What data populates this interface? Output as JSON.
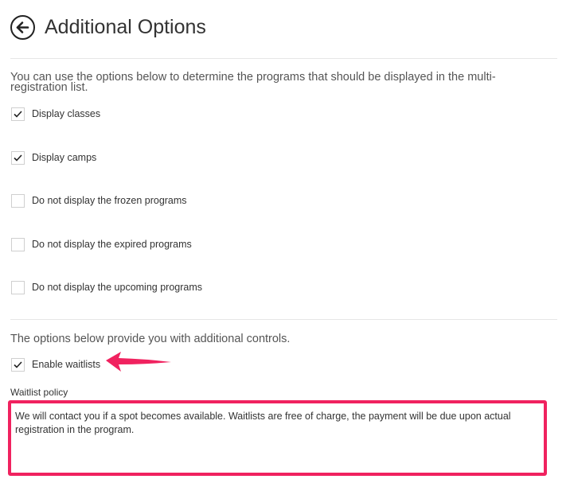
{
  "header": {
    "title": "Additional Options"
  },
  "intro_text": "You can use the options below to determine the programs that should be displayed in the multi-registration list.",
  "options": [
    {
      "label": "Display classes",
      "checked": true
    },
    {
      "label": "Display camps",
      "checked": true
    },
    {
      "label": "Do not display the frozen programs",
      "checked": false
    },
    {
      "label": "Do not display the expired programs",
      "checked": false
    },
    {
      "label": "Do not display the upcoming programs",
      "checked": false
    }
  ],
  "controls_text": "The options below provide you with additional controls.",
  "waitlist": {
    "label": "Enable waitlists",
    "checked": true
  },
  "policy": {
    "label": "Waitlist policy",
    "value": "We will contact you if a spot becomes available. Waitlists are free of charge, the payment will be due upon actual registration in the program."
  },
  "colors": {
    "highlight": "#f0225f",
    "checkmark": "#222222",
    "divider": "#e6e6e6"
  },
  "icons": {
    "back": "back-arrow-icon",
    "check": "checkmark-icon",
    "annotation": "annotation-arrow-icon"
  }
}
